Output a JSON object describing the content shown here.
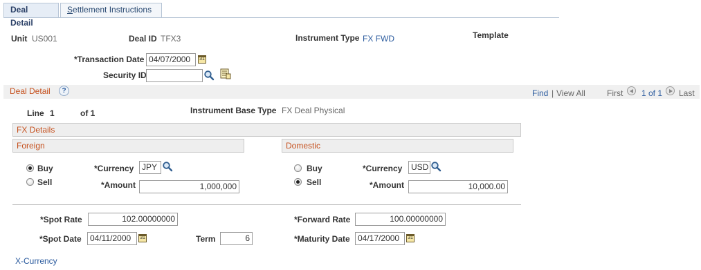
{
  "tabs": [
    {
      "label": "Deal Detail"
    },
    {
      "label_first": "S",
      "label_rest": "ettlement Instructions"
    }
  ],
  "header": {
    "unit_label": "Unit",
    "unit_value": "US001",
    "deal_id_label": "Deal ID",
    "deal_id_value": "TFX3",
    "instrument_type_label": "Instrument Type",
    "instrument_type_value": "FX FWD",
    "template_label": "Template",
    "transaction_date_label": "*Transaction Date",
    "transaction_date_value": "04/07/2000",
    "security_id_label": "Security ID",
    "security_id_value": ""
  },
  "deal_detail": {
    "title": "Deal Detail",
    "help_icon_text": "?",
    "find_label": "Find",
    "separator": "|",
    "view_all_label": "View All",
    "first_label": "First",
    "page_info": "1 of 1",
    "last_label": "Last",
    "line_label": "Line",
    "line_value": "1",
    "of_label": "of 1",
    "instrument_base_type_label": "Instrument Base Type",
    "instrument_base_type_value": "FX Deal Physical"
  },
  "fx_details": {
    "title": "FX Details",
    "foreign": {
      "title": "Foreign",
      "buy_label": "Buy",
      "sell_label": "Sell",
      "selected": "Buy",
      "currency_label": "*Currency",
      "currency_value": "JPY",
      "amount_label": "*Amount",
      "amount_value": "1,000,000"
    },
    "domestic": {
      "title": "Domestic",
      "buy_label": "Buy",
      "sell_label": "Sell",
      "selected": "Sell",
      "currency_label": "*Currency",
      "currency_value": "USD",
      "amount_label": "*Amount",
      "amount_value": "10,000.00"
    }
  },
  "rates": {
    "spot_rate_label": "*Spot Rate",
    "spot_rate_value": "102.00000000",
    "forward_rate_label": "*Forward Rate",
    "forward_rate_value": "100.00000000",
    "spot_date_label": "*Spot Date",
    "spot_date_value": "04/11/2000",
    "term_label": "Term",
    "term_value": "6",
    "maturity_date_label": "*Maturity Date",
    "maturity_date_value": "04/17/2000"
  },
  "x_currency_link": "X-Currency",
  "icons": {
    "calendar": "calendar-icon",
    "lookup": "magnifier-icon",
    "detail": "detail-view-icon",
    "help": "help-icon"
  },
  "colors": {
    "link": "#2b5b9e",
    "section_title": "#c5501d",
    "tab_border": "#b7c5d6",
    "section_bar": "#eeeeee"
  }
}
